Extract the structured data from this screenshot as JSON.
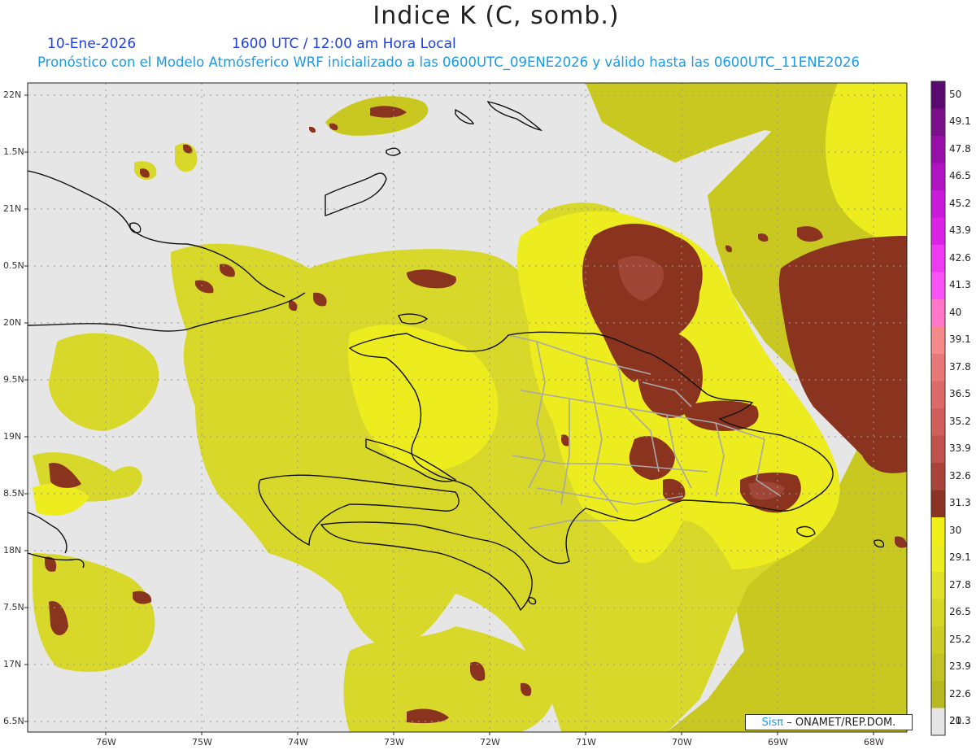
{
  "header": {
    "title": "Indice K (C, somb.)",
    "date": "10-Ene-2026",
    "time": "1600 UTC / 12:00 am Hora Local",
    "forecast_line": "Pronóstico con el Modelo Atmósferico WRF inicializado a las 0600UTC_09ENE2026 y válido hasta las  0600UTC_11ENE2026"
  },
  "axes": {
    "lat_labels": [
      "22N",
      "1.5N",
      "21N",
      "0.5N",
      "20N",
      "9.5N",
      "19N",
      "8.5N",
      "18N",
      "7.5N",
      "17N",
      "6.5N"
    ],
    "lon_labels": [
      "76W",
      "75W",
      "74W",
      "73W",
      "72W",
      "71W",
      "70W",
      "69W",
      "68W"
    ]
  },
  "colorbar": {
    "labels": [
      "50",
      "49.1",
      "47.8",
      "46.5",
      "45.2",
      "43.9",
      "42.6",
      "41.3",
      "40",
      "39.1",
      "37.8",
      "36.5",
      "35.2",
      "33.9",
      "32.6",
      "31.3",
      "30",
      "29.1",
      "27.8",
      "26.5",
      "25.2",
      "23.9",
      "22.6",
      "21.3",
      "20"
    ],
    "colors": [
      "#5a0a6e",
      "#7a108a",
      "#9610a8",
      "#b014c2",
      "#c81ad8",
      "#dc22e6",
      "#ee3af0",
      "#f852f4",
      "#ff78c8",
      "#f48a8a",
      "#e87878",
      "#dc6a68",
      "#d05e5a",
      "#c0524c",
      "#a8443c",
      "#8c3424",
      "#f0f018",
      "#ecec22",
      "#e0e02a",
      "#d6d628",
      "#cccc26",
      "#c2c224",
      "#b8b822",
      "#e6e6e6"
    ]
  },
  "credit": {
    "sis": "Sisπ",
    "rest": "– ONAMET/REP.DOM."
  }
}
